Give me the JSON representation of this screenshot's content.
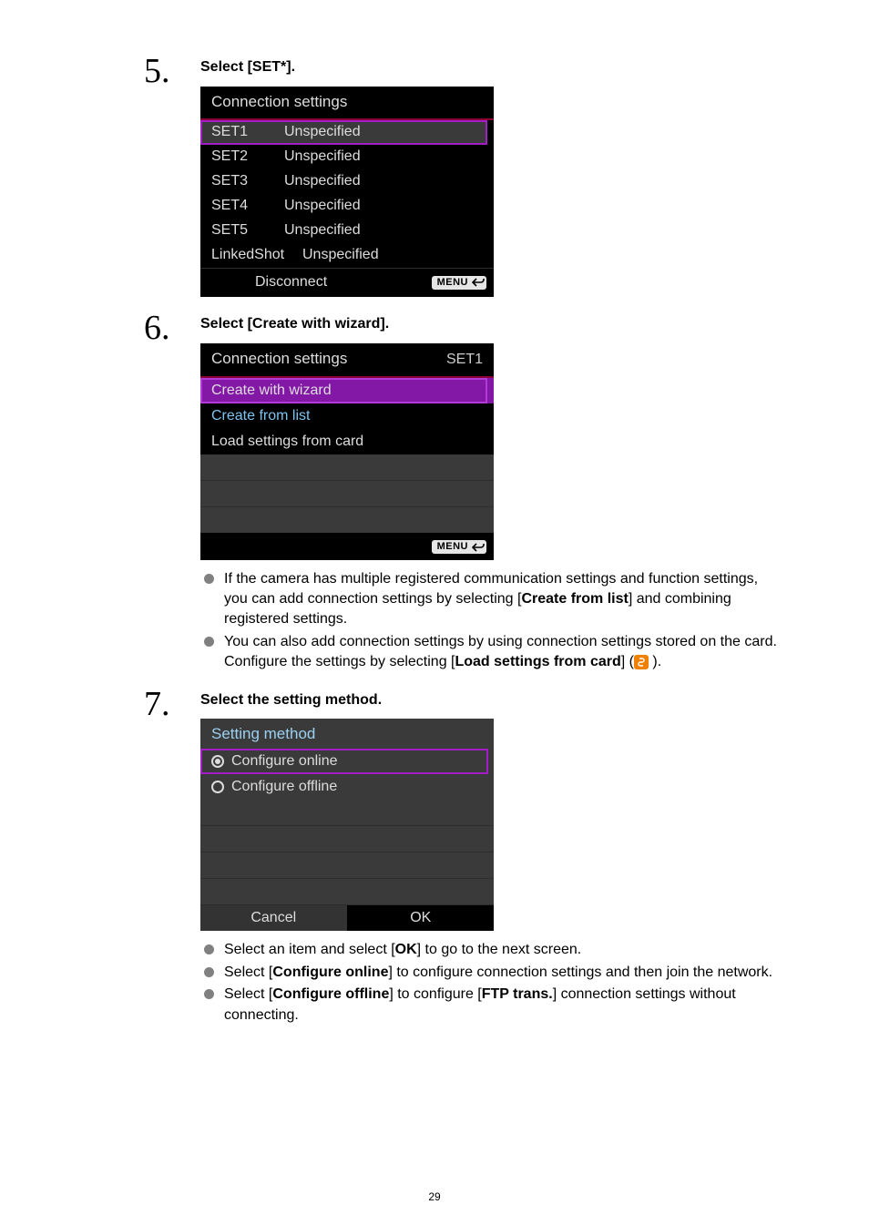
{
  "pageNumber": "29",
  "step5": {
    "number": "5.",
    "heading": "Select [SET*].",
    "ss": {
      "title": "Connection settings",
      "rows": [
        {
          "c1": "SET1",
          "c2": "Unspecified"
        },
        {
          "c1": "SET2",
          "c2": "Unspecified"
        },
        {
          "c1": "SET3",
          "c2": "Unspecified"
        },
        {
          "c1": "SET4",
          "c2": "Unspecified"
        },
        {
          "c1": "SET5",
          "c2": "Unspecified"
        },
        {
          "c1": "LinkedShot",
          "c2": "Unspecified"
        }
      ],
      "disconnect": "Disconnect",
      "menu": "MENU"
    }
  },
  "step6": {
    "number": "6.",
    "heading": "Select [Create with wizard].",
    "ss": {
      "title": "Connection settings",
      "titleRight": "SET1",
      "items": [
        "Create with wizard",
        "Create from list",
        "Load settings from card"
      ],
      "menu": "MENU"
    },
    "bullets": {
      "b1a": "If the camera has multiple registered communication settings and function settings, you can add connection settings by selecting [",
      "b1bold": "Create from list",
      "b1b": "] and combining registered settings.",
      "b2a": "You can also add connection settings by using connection settings stored on the card. Configure the settings by selecting [",
      "b2bold": "Load settings from card",
      "b2b": "] (",
      "b2c": " )."
    }
  },
  "step7": {
    "number": "7.",
    "heading": "Select the setting method.",
    "ss": {
      "title": "Setting method",
      "opt1": "Configure online",
      "opt2": "Configure offline",
      "cancel": "Cancel",
      "ok": "OK"
    },
    "bullets": {
      "b1a": "Select an item and select [",
      "b1bold": "OK",
      "b1b": "] to go to the next screen.",
      "b2a": "Select [",
      "b2bold": "Configure online",
      "b2b": "] to configure connection settings and then join the network.",
      "b3a": "Select [",
      "b3bold1": "Configure offline",
      "b3b": "] to configure [",
      "b3bold2": "FTP trans.",
      "b3c": "] connection settings without connecting."
    }
  }
}
